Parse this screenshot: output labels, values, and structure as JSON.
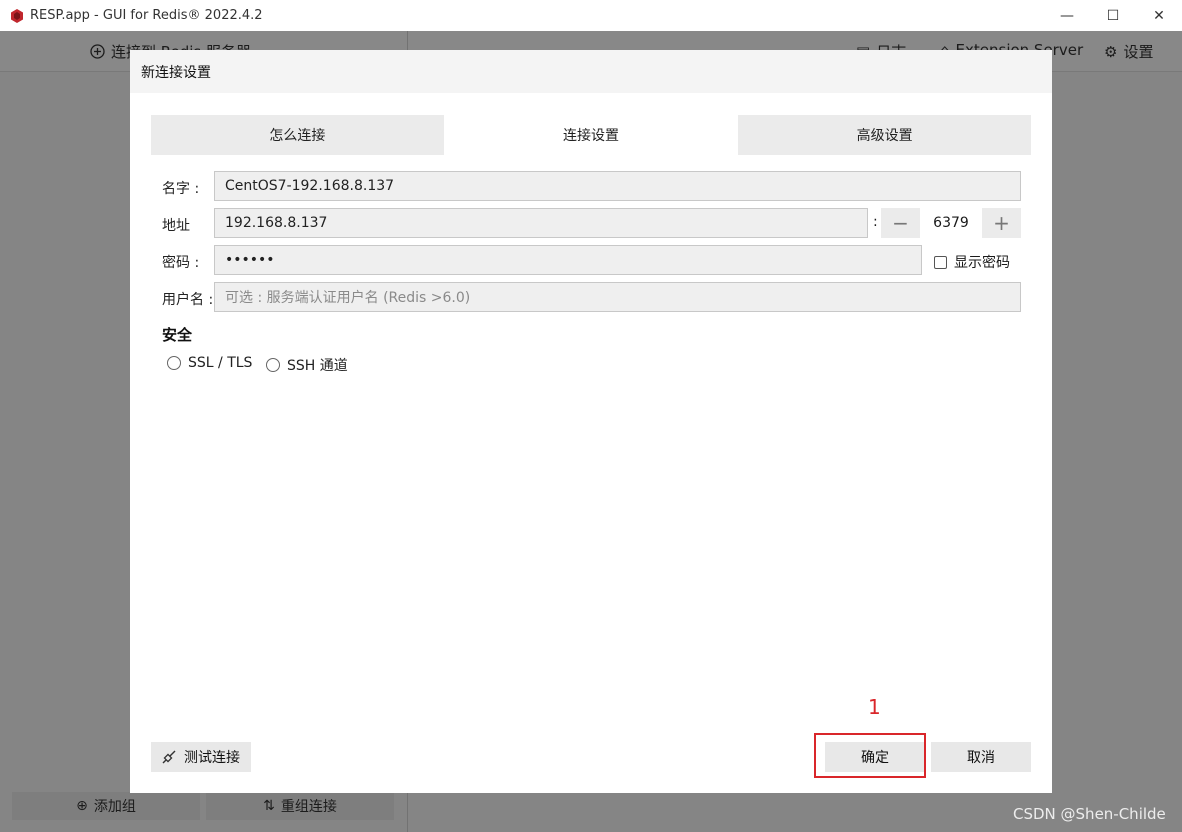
{
  "window": {
    "title": "RESP.app - GUI for Redis® 2022.4.2",
    "controls": {
      "minimize": "—",
      "maximize": "☐",
      "close": "✕"
    }
  },
  "background_app": {
    "connect_label": "连接到 Redis 服务器",
    "log_label": "日志",
    "extension_label": "Extension Server",
    "settings_label": "设置",
    "add_group_label": "添加组",
    "regroup_label": "重组连接"
  },
  "dialog": {
    "title": "新连接设置",
    "tabs": [
      {
        "label": "怎么连接",
        "active": false
      },
      {
        "label": "连接设置",
        "active": true
      },
      {
        "label": "高级设置",
        "active": false
      }
    ],
    "fields": {
      "name_label": "名字 :",
      "name_value": "CentOS7-192.168.8.137",
      "address_label": "地址",
      "address_value": "192.168.8.137",
      "port_separator": ":",
      "port_value": "6379",
      "password_label": "密码 :",
      "password_value": "••••••",
      "show_password_label": "显示密码",
      "username_label": "用户名 :",
      "username_placeholder": "可选 : 服务端认证用户名 (Redis >6.0)"
    },
    "security": {
      "title": "安全",
      "options": [
        "SSL / TLS",
        "SSH 通道"
      ]
    },
    "buttons": {
      "test_connection": "测试连接",
      "ok": "确定",
      "cancel": "取消"
    }
  },
  "annotation": {
    "number": "1",
    "color": "#d9262a"
  },
  "watermark": "CSDN @Shen-Childe"
}
